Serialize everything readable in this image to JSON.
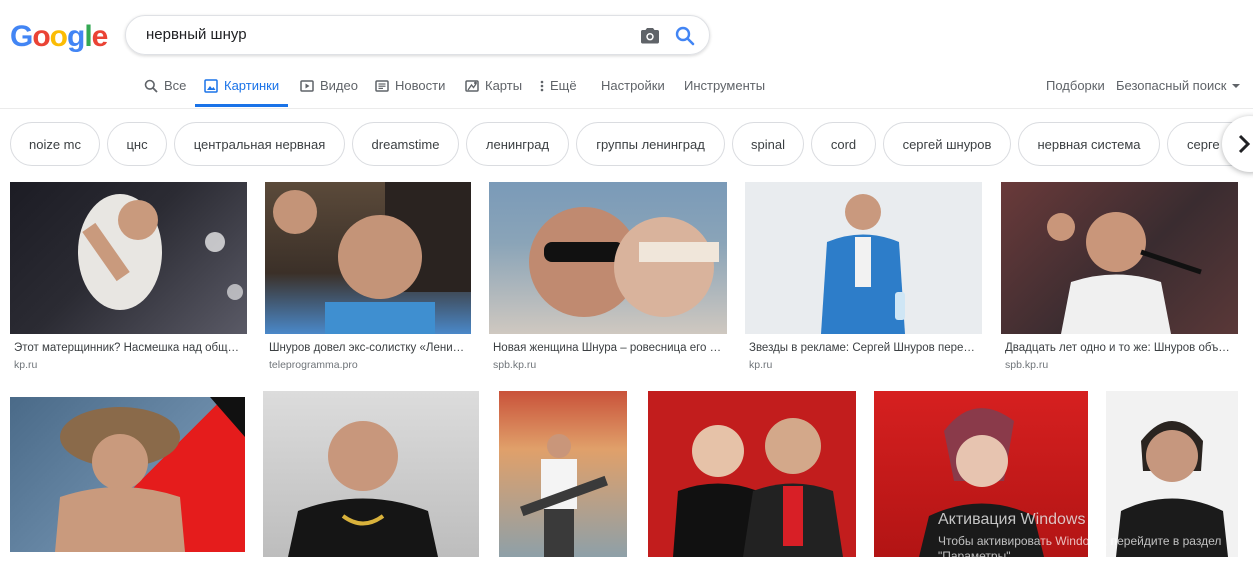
{
  "logo": {
    "letters": [
      "G",
      "o",
      "o",
      "g",
      "l",
      "e"
    ],
    "colors": [
      "#4285f4",
      "#ea4335",
      "#fbbc05",
      "#4285f4",
      "#34a853",
      "#ea4335"
    ]
  },
  "search": {
    "query": "нервный шнур"
  },
  "tabs": [
    {
      "label": "Все",
      "icon": "search-icon"
    },
    {
      "label": "Картинки",
      "icon": "image-icon"
    },
    {
      "label": "Видео",
      "icon": "video-icon"
    },
    {
      "label": "Новости",
      "icon": "news-icon"
    },
    {
      "label": "Карты",
      "icon": "map-icon"
    },
    {
      "label": "Ещё",
      "icon": "more-icon"
    },
    {
      "label": "Настройки"
    },
    {
      "label": "Инструменты"
    }
  ],
  "right_links": {
    "collections": "Подборки",
    "safe_search": "Безопасный поиск"
  },
  "chips": [
    "noize mc",
    "цнс",
    "центральная нервная",
    "dreamstime",
    "ленинград",
    "группы ленинград",
    "spinal",
    "cord",
    "сергей шнуров",
    "нервная система",
    "серге"
  ],
  "results_row1": [
    {
      "caption": "Этот матерщинник? Насмешка над обще…",
      "source": "kp.ru"
    },
    {
      "caption": "Шнуров довел экс-солистку «Лени…",
      "source": "teleprogramma.pro"
    },
    {
      "caption": "Новая женщина Шнура – ровесница его …",
      "source": "spb.kp.ru"
    },
    {
      "caption": "Звезды в рекламе: Сергей Шнуров переш…",
      "source": "kp.ru"
    },
    {
      "caption": "Двадцать лет одно и то же: Шнуров объя…",
      "source": "spb.kp.ru"
    }
  ],
  "watermark": {
    "title": "Активация Windows",
    "subtitle": "Чтобы активировать Windows, перейдите в раздел \"Параметры\"."
  },
  "accent": "#1a73e8"
}
